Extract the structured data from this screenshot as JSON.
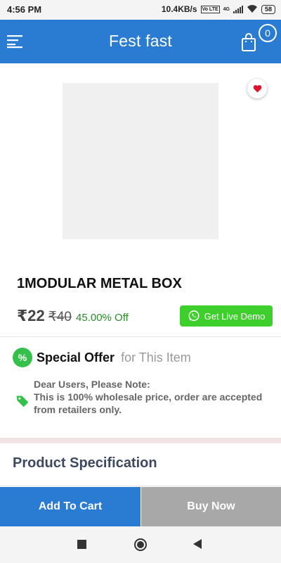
{
  "status_bar": {
    "time": "4:56 PM",
    "network_speed": "10.4KB/s",
    "volte": "Vo LTE",
    "network_type": "4G",
    "battery": "58"
  },
  "header": {
    "title": "Fest fast",
    "cart_count": "0",
    "menu_icon": "hamburger-menu-icon",
    "cart_icon": "shopping-bag-icon"
  },
  "product": {
    "wishlist_icon": "heart-icon",
    "name": "1MODULAR METAL BOX",
    "price": "₹22",
    "original_price": "₹40",
    "discount": "45.00% Off",
    "live_demo_label": "Get Live Demo",
    "live_demo_icon": "whatsapp-icon"
  },
  "offer": {
    "badge_icon": "percent-icon",
    "title_strong": "Special Offer",
    "title_muted": "for This Item",
    "tag_icon": "tag-icon",
    "note_heading": "Dear Users, Please Note:",
    "note_body": "This is 100% wholesale price, order are accepted from retailers only."
  },
  "specification": {
    "title": "Product Specification"
  },
  "actions": {
    "add_to_cart": "Add To Cart",
    "buy_now": "Buy Now"
  },
  "colors": {
    "primary": "#2a7bd2",
    "whatsapp_green": "#3ecf2c",
    "discount_green": "#2b8a2b",
    "buy_now_gray": "#a8a8a8",
    "heart_red": "#e0132b"
  }
}
